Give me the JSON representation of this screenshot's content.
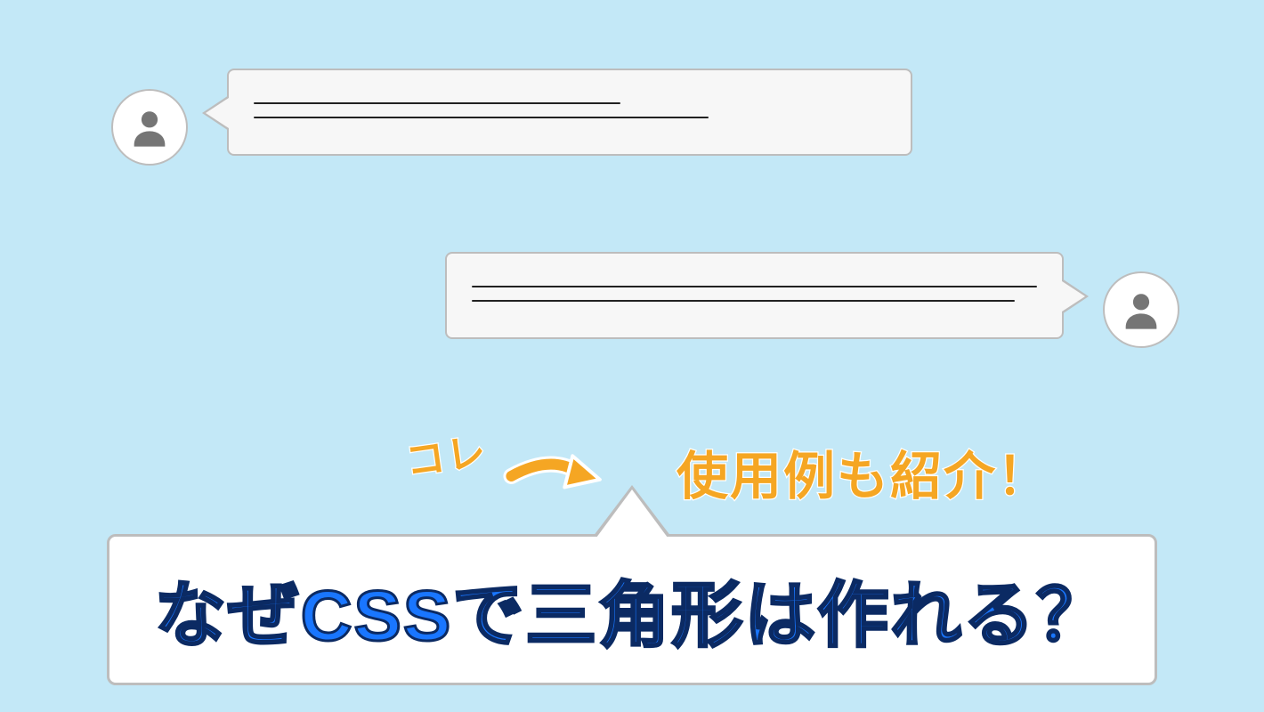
{
  "colors": {
    "background": "#c3e8f7",
    "bubble_fill": "#f7f7f7",
    "bubble_border": "#bdbdbd",
    "avatar_fill": "#757575",
    "accent_yellow": "#f5a623",
    "title_blue": "#1976ff",
    "title_outline": "#0b2a63"
  },
  "annotations": {
    "pointer_label": "コレ",
    "subtitle": "使用例も紹介！"
  },
  "hero": {
    "title": "なぜCSSで三角形は作れる？"
  }
}
